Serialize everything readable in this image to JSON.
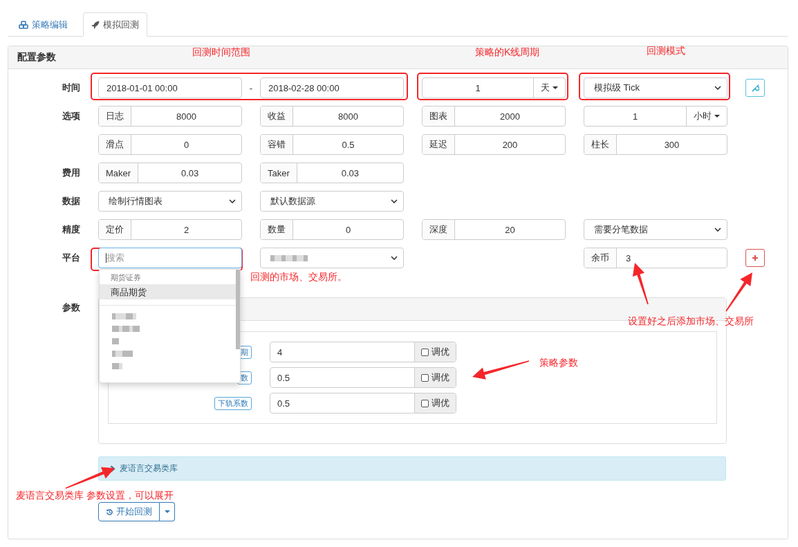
{
  "tabs": [
    {
      "label": "策略编辑",
      "selected": false
    },
    {
      "label": "模拟回测",
      "selected": true
    }
  ],
  "panel": {
    "title": "配置参数"
  },
  "rows": [
    {
      "label": "时间",
      "cells": [
        {
          "kind": "date-range",
          "start": "2018-01-01 00:00",
          "separator": "-",
          "end": "2018-02-28 00:00"
        },
        {
          "kind": "input-dropdown",
          "value": "1",
          "unit": "天"
        },
        {
          "kind": "select",
          "value": "模拟级 Tick"
        },
        {
          "kind": "settings"
        }
      ]
    },
    {
      "label": "选项",
      "cells": [
        {
          "kind": "addon-input",
          "addon": "日志",
          "value": "8000"
        },
        {
          "kind": "addon-input",
          "addon": "收益",
          "value": "8000"
        },
        {
          "kind": "addon-input",
          "addon": "图表",
          "value": "2000"
        },
        {
          "kind": "input-dropdown",
          "value": "1",
          "unit": "小时"
        }
      ]
    },
    {
      "label": "",
      "cells": [
        {
          "kind": "addon-input",
          "addon": "滑点",
          "value": "0"
        },
        {
          "kind": "addon-input",
          "addon": "容错",
          "value": "0.5"
        },
        {
          "kind": "addon-input",
          "addon": "延迟",
          "value": "200"
        },
        {
          "kind": "addon-input",
          "addon": "柱长",
          "value": "300"
        }
      ]
    },
    {
      "label": "费用",
      "cells": [
        {
          "kind": "addon-input",
          "addon": "Maker",
          "value": "0.03"
        },
        {
          "kind": "addon-input",
          "addon": "Taker",
          "value": "0.03"
        }
      ]
    },
    {
      "label": "数据",
      "cells": [
        {
          "kind": "select",
          "value": "绘制行情图表"
        },
        {
          "kind": "select",
          "value": "默认数据源"
        }
      ]
    },
    {
      "label": "精度",
      "cells": [
        {
          "kind": "addon-input",
          "addon": "定价",
          "value": "2"
        },
        {
          "kind": "addon-input",
          "addon": "数量",
          "value": "0"
        },
        {
          "kind": "addon-input",
          "addon": "深度",
          "value": "20"
        },
        {
          "kind": "select",
          "value": "需要分笔数据"
        }
      ]
    },
    {
      "label": "平台",
      "cells": [
        {
          "kind": "search",
          "placeholder": "搜索",
          "dropdown": {
            "header": "期货证券",
            "items": [
              {
                "label": "商品期货",
                "selected": true
              }
            ],
            "hidden_items": [
              {
                "kind": "blurred"
              },
              {
                "kind": "blurred"
              },
              {
                "kind": "blurred"
              },
              {
                "kind": "blurred"
              },
              {
                "kind": "blurred"
              }
            ]
          }
        },
        {
          "kind": "blurred-select"
        },
        {
          "kind": "empty"
        },
        {
          "kind": "addon-text",
          "addon": "余币",
          "value": "3"
        },
        {
          "kind": "add"
        }
      ]
    }
  ],
  "params": {
    "label": "参数",
    "items": [
      {
        "label": "期",
        "value": "4",
        "tune": "调优",
        "checked": false
      },
      {
        "label": "数",
        "value": "0.5",
        "tune": "调优",
        "checked": false
      },
      {
        "label": "下轨系数",
        "value": "0.5",
        "tune": "调优",
        "checked": false
      }
    ]
  },
  "library": {
    "title": "麦语言交易类库",
    "expanded": false
  },
  "start_button": {
    "label": "开始回测"
  },
  "annotations": [
    {
      "kind": "note",
      "text": "回测时间范围"
    },
    {
      "kind": "note",
      "text": "策略的K线周期"
    },
    {
      "kind": "note",
      "text": "回测模式"
    },
    {
      "kind": "note",
      "text": "回测的市场、交易所。"
    },
    {
      "kind": "note",
      "text": "设置好之后添加市场、交易所"
    },
    {
      "kind": "note",
      "text": "策略参数"
    },
    {
      "kind": "note",
      "text": "麦语言交易类库 参数设置，可以展开"
    }
  ]
}
